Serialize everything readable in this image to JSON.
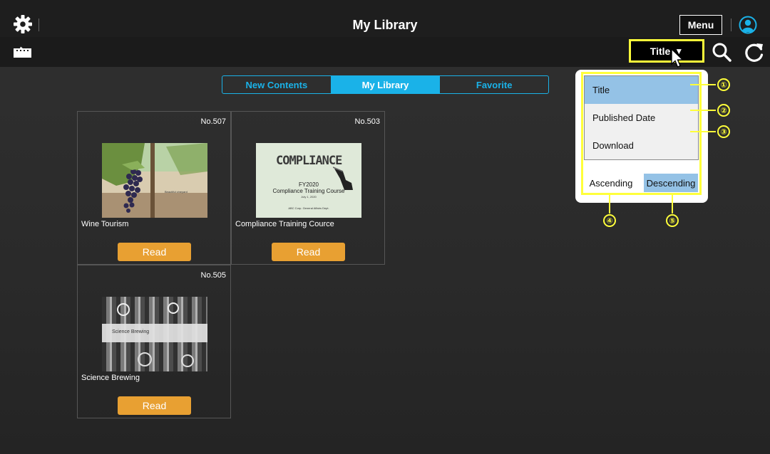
{
  "header": {
    "title": "My Library",
    "menu_label": "Menu",
    "settings_icon": "gear-icon",
    "user_icon": "user-icon"
  },
  "toolbar": {
    "sort_label": "Title",
    "sort_arrow": "▼",
    "folder_icon": "folder-icon",
    "search_icon": "search-icon",
    "refresh_icon": "refresh-icon"
  },
  "tabs": [
    {
      "label": "New Contents",
      "active": false
    },
    {
      "label": "My Library",
      "active": true
    },
    {
      "label": "Favorite",
      "active": false
    }
  ],
  "cards": [
    {
      "number": "No.507",
      "title": "Wine Tourism",
      "read_label": "Read",
      "thumb_caption": "Beautiful vineyard"
    },
    {
      "number": "No.503",
      "title": "Compliance Training Cource",
      "read_label": "Read",
      "thumb_heading": "COMPLIANCE",
      "thumb_line1": "FY2020",
      "thumb_line2": "Compliance Training Course",
      "thumb_line3": "July 1, 2020",
      "thumb_footer": "ABC Corp. General Affairs Dept."
    },
    {
      "number": "No.505",
      "title": "Science Brewing",
      "read_label": "Read",
      "thumb_caption": "Science Brewing"
    }
  ],
  "sort_popup": {
    "options": [
      {
        "label": "Title",
        "selected": true
      },
      {
        "label": "Published Date",
        "selected": false
      },
      {
        "label": "Download",
        "selected": false
      }
    ],
    "order": [
      {
        "label": "Ascending",
        "selected": false
      },
      {
        "label": "Descending",
        "selected": true
      }
    ]
  },
  "callouts": [
    "①",
    "②",
    "③",
    "④",
    "⑤"
  ],
  "colors": {
    "accent": "#1ab2e8",
    "read_button": "#e8a032",
    "highlight": "#ffff3a",
    "selected_option": "#94c2e6",
    "topbar": "#1e1e1e"
  }
}
